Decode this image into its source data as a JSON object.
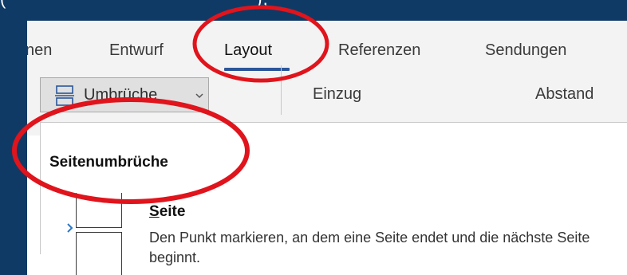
{
  "tabs": {
    "partial": "nen",
    "entwurf": "Entwurf",
    "layout": "Layout",
    "referenzen": "Referenzen",
    "sendungen": "Sendungen",
    "active": "Layout"
  },
  "ribbon": {
    "umbrueche_label": "Umbrüche",
    "einzug_label": "Einzug",
    "abstand_label": "Abstand"
  },
  "dropdown": {
    "section_header": "Seitenumbrüche",
    "options": [
      {
        "title_first": "S",
        "title_rest": "eite",
        "description": "Den Punkt markieren, an dem eine Seite endet und die nächste Seite beginnt."
      }
    ]
  },
  "colors": {
    "background": "#0f3a66",
    "annotation": "#e0141c",
    "accent": "#2b579a",
    "ribbon": "#f3f3f3"
  },
  "icons": [
    "page-break-icon",
    "chevron-down-icon",
    "caret-right-icon",
    "page-thumbnail-icon"
  ]
}
